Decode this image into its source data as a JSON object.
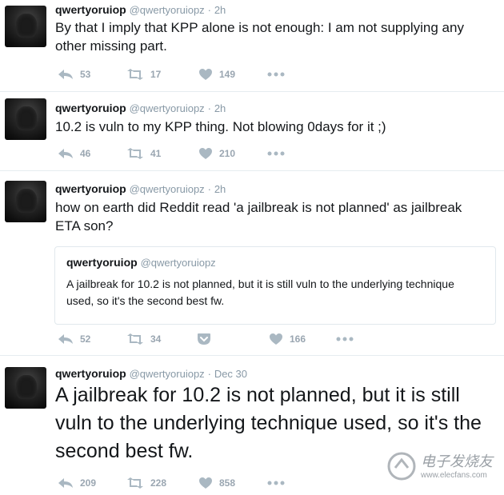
{
  "tweets": [
    {
      "name": "qwertyoruiop",
      "handle": "@qwertyoruiopz",
      "time": "2h",
      "text": "By that I imply that KPP alone is not enough: I am not supplying any other missing part.",
      "replies": "53",
      "retweets": "17",
      "likes": "149"
    },
    {
      "name": "qwertyoruiop",
      "handle": "@qwertyoruiopz",
      "time": "2h",
      "text": "10.2 is vuln to my KPP thing. Not blowing 0days for it ;)",
      "replies": "46",
      "retweets": "41",
      "likes": "210"
    },
    {
      "name": "qwertyoruiop",
      "handle": "@qwertyoruiopz",
      "time": "2h",
      "text": "how on earth did Reddit read 'a jailbreak is not planned' as jailbreak ETA son?",
      "quote": {
        "name": "qwertyoruiop",
        "handle": "@qwertyoruiopz",
        "text": "A jailbreak for 10.2 is not planned, but it is still vuln to the underlying technique used, so it's the second best fw."
      },
      "replies": "52",
      "retweets": "34",
      "likes": "166"
    },
    {
      "name": "qwertyoruiop",
      "handle": "@qwertyoruiopz",
      "time": "Dec 30",
      "text": "A jailbreak for 10.2 is not planned, but it is still vuln to the underlying technique used, so it's the second best fw.",
      "replies": "209",
      "retweets": "228",
      "likes": "858"
    }
  ],
  "separator": "·",
  "watermark": {
    "title": "电子发烧友",
    "url": "www.elecfans.com"
  },
  "colors": {
    "text": "#14171a",
    "muted": "#8899a6",
    "icon": "#aab8c2",
    "border": "#e6ecf0"
  }
}
